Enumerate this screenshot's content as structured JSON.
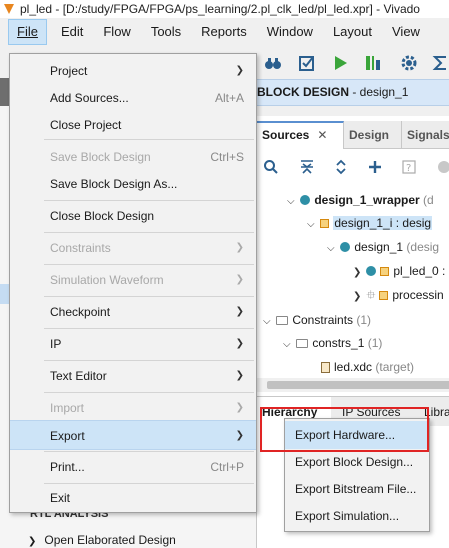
{
  "window": {
    "title": "pl_led - [D:/study/FPGA/FPGA/ps_learning/2.pl_clk_led/pl_led.xpr] - Vivado"
  },
  "menubar": {
    "items": [
      "File",
      "Edit",
      "Flow",
      "Tools",
      "Reports",
      "Window",
      "Layout",
      "View"
    ]
  },
  "file_menu": {
    "project": "Project",
    "add_sources": "Add Sources...",
    "add_sources_shortcut": "Alt+A",
    "close_project": "Close Project",
    "save_block_design": "Save Block Design",
    "save_block_design_shortcut": "Ctrl+S",
    "save_block_design_as": "Save Block Design As...",
    "close_block_design": "Close Block Design",
    "constraints": "Constraints",
    "simulation_waveform": "Simulation Waveform",
    "checkpoint": "Checkpoint",
    "ip": "IP",
    "text_editor": "Text Editor",
    "import": "Import",
    "export": "Export",
    "print": "Print...",
    "print_shortcut": "Ctrl+P",
    "exit": "Exit"
  },
  "export_submenu": {
    "items": [
      "Export Hardware...",
      "Export Block Design...",
      "Export Bitstream File...",
      "Export Simulation..."
    ]
  },
  "block_design": {
    "header_bold": "BLOCK DESIGN",
    "header_rest": " - design_1"
  },
  "sources": {
    "tabs": [
      "Sources",
      "Design",
      "Signals"
    ],
    "tree": {
      "wrapper": "design_1_wrapper",
      "wrapper_suffix": " (d",
      "inst": "design_1_i : desig",
      "design": "design_1",
      "design_suffix": " (desig",
      "pl_led": "pl_led_0 :",
      "processing": "processin",
      "constraints": "Constraints",
      "constraints_count": " (1)",
      "constrs": "constrs_1",
      "constrs_count": " (1)",
      "file": "led.xdc",
      "file_suffix": " (target)"
    },
    "bottom_tabs": [
      "Hierarchy",
      "IP Sources",
      "Libra"
    ]
  },
  "left_panel": {
    "rtl_analysis": "RTL ANALYSIS",
    "open_elaborated": "Open Elaborated Design"
  },
  "colors": {
    "highlight": "#cde4f7",
    "callout": "#e02424"
  }
}
